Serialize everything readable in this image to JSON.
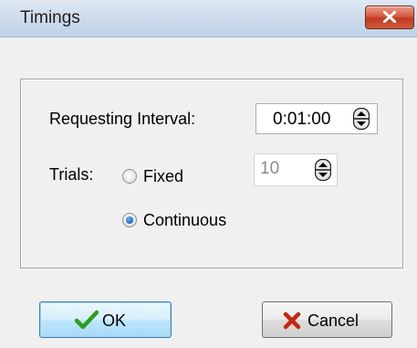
{
  "window": {
    "title": "Timings",
    "close_icon": "close-x-icon"
  },
  "group": {
    "interval_label": "Requesting Interval:",
    "interval_value": "0:01:00",
    "trials_label": "Trials:",
    "fixed_label": "Fixed",
    "fixed_value": "10",
    "continuous_label": "Continuous",
    "selected_trial_mode": "Continuous"
  },
  "buttons": {
    "ok_label": "OK",
    "cancel_label": "Cancel"
  },
  "colors": {
    "ok_check": "#2f9e1b",
    "cancel_x": "#c4260f",
    "close_button": "#c2391f"
  }
}
